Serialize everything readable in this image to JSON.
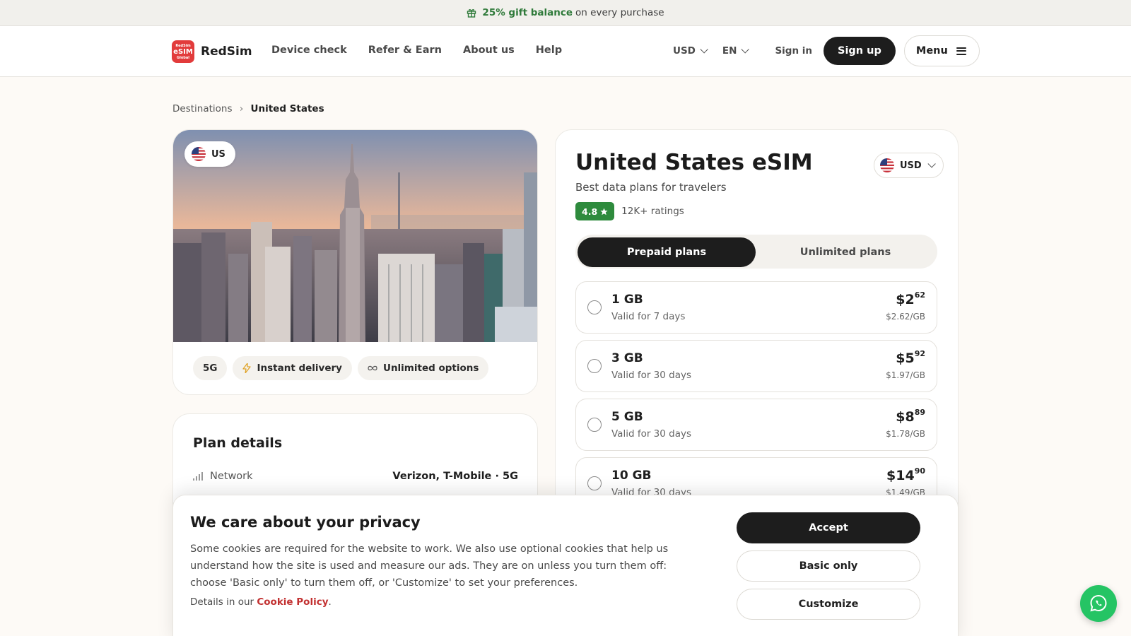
{
  "promo": {
    "highlight": "25% gift balance",
    "rest": "on every purchase",
    "icon": "gift-icon"
  },
  "header": {
    "logo_badge_top": "RedSim",
    "logo_badge_main": "eSIM",
    "logo_badge_bottom": "Global",
    "brand": "RedSim",
    "nav": [
      "Device check",
      "Refer & Earn",
      "About us",
      "Help"
    ],
    "currency": "USD",
    "language": "EN",
    "sign_in": "Sign in",
    "sign_up": "Sign up",
    "menu": "Menu"
  },
  "breadcrumb": {
    "parent": "Destinations",
    "separator": "›",
    "current": "United States"
  },
  "hero": {
    "country_code": "US",
    "chips": [
      "5G",
      "Instant delivery",
      "Unlimited options"
    ]
  },
  "details": {
    "title": "Plan details",
    "rows": [
      {
        "label": "Network",
        "value": "Verizon, T-Mobile · 5G"
      }
    ]
  },
  "plans": {
    "title": "United States eSIM",
    "subtitle": "Best data plans for travelers",
    "rating": "4.8",
    "rating_count": "12K+ ratings",
    "currency": "USD",
    "tabs": {
      "active": "Prepaid plans",
      "inactive": "Unlimited plans"
    },
    "items": [
      {
        "gb": "1 GB",
        "valid": "Valid for 7 days",
        "price_main": "$2",
        "price_cents": "62",
        "per_gb": "$2.62/GB"
      },
      {
        "gb": "3 GB",
        "valid": "Valid for 30 days",
        "price_main": "$5",
        "price_cents": "92",
        "per_gb": "$1.97/GB"
      },
      {
        "gb": "5 GB",
        "valid": "Valid for 30 days",
        "price_main": "$8",
        "price_cents": "89",
        "per_gb": "$1.78/GB"
      },
      {
        "gb": "10 GB",
        "valid": "Valid for 30 days",
        "price_main": "$14",
        "price_cents": "90",
        "per_gb": "$1.49/GB"
      }
    ]
  },
  "cookie": {
    "title": "We care about your privacy",
    "body": "Some cookies are required for the website to work. We also use optional cookies that help us understand how the site is used and measure our ads. They are on unless you turn them off: choose 'Basic only' to turn them off, or 'Customize' to set your preferences.",
    "details_prefix": "Details in our",
    "policy_link": "Cookie Policy",
    "details_suffix": ".",
    "accept": "Accept",
    "basic": "Basic only",
    "customize": "Customize"
  },
  "colors": {
    "accent": "#1d1d1d",
    "brand_red": "#e23b3b",
    "rating_green": "#2e8b3d",
    "whatsapp": "#25c464",
    "link_red": "#c23030"
  }
}
